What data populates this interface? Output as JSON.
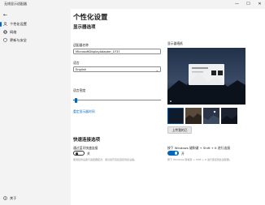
{
  "window": {
    "title": "无线显示适配器",
    "controls": [
      "—",
      "☐",
      "✕"
    ]
  },
  "sidebar": {
    "back_glyph": "←",
    "items": [
      {
        "label": "个性化设置",
        "icon": "person-icon",
        "selected": true
      },
      {
        "label": "网络",
        "icon": "globe-icon",
        "selected": false
      },
      {
        "label": "更新与安全",
        "icon": "shield-icon",
        "selected": false
      }
    ],
    "about": {
      "label": "关于",
      "icon": "info-icon"
    }
  },
  "main": {
    "title": "个性化设置",
    "display_section": {
      "heading": "显示器选项",
      "name_label": "适配器名称",
      "name_value": "MicrosoftDisplayAdapter_1F37",
      "language_label": "语言",
      "language_value": "English",
      "density_label": "语言密度",
      "density_level": 0.03,
      "reset_link": "重定显示器时间"
    },
    "wallpaper": {
      "label": "显示器墙纸",
      "upload_button": "上传我的已",
      "thumbnails": 4
    },
    "quick_connect": {
      "heading": "快速连接选项",
      "left": {
        "label": "通过蓝牙快速连接",
        "state": "关",
        "on": false,
        "description": "使用您的设备与适配器配对，通过蓝牙直接连接到此设备。"
      },
      "right": {
        "label": "按下 Windows 键和键 + Shift + K 进行连接",
        "state": "开",
        "on": true,
        "description": "按下 Windows 键和键 + Shift + K 进行连接到此适配器。"
      }
    }
  },
  "colors": {
    "accent": "#0067c0",
    "window_bg": "#f3f3f3",
    "content_bg": "#ffffff"
  }
}
